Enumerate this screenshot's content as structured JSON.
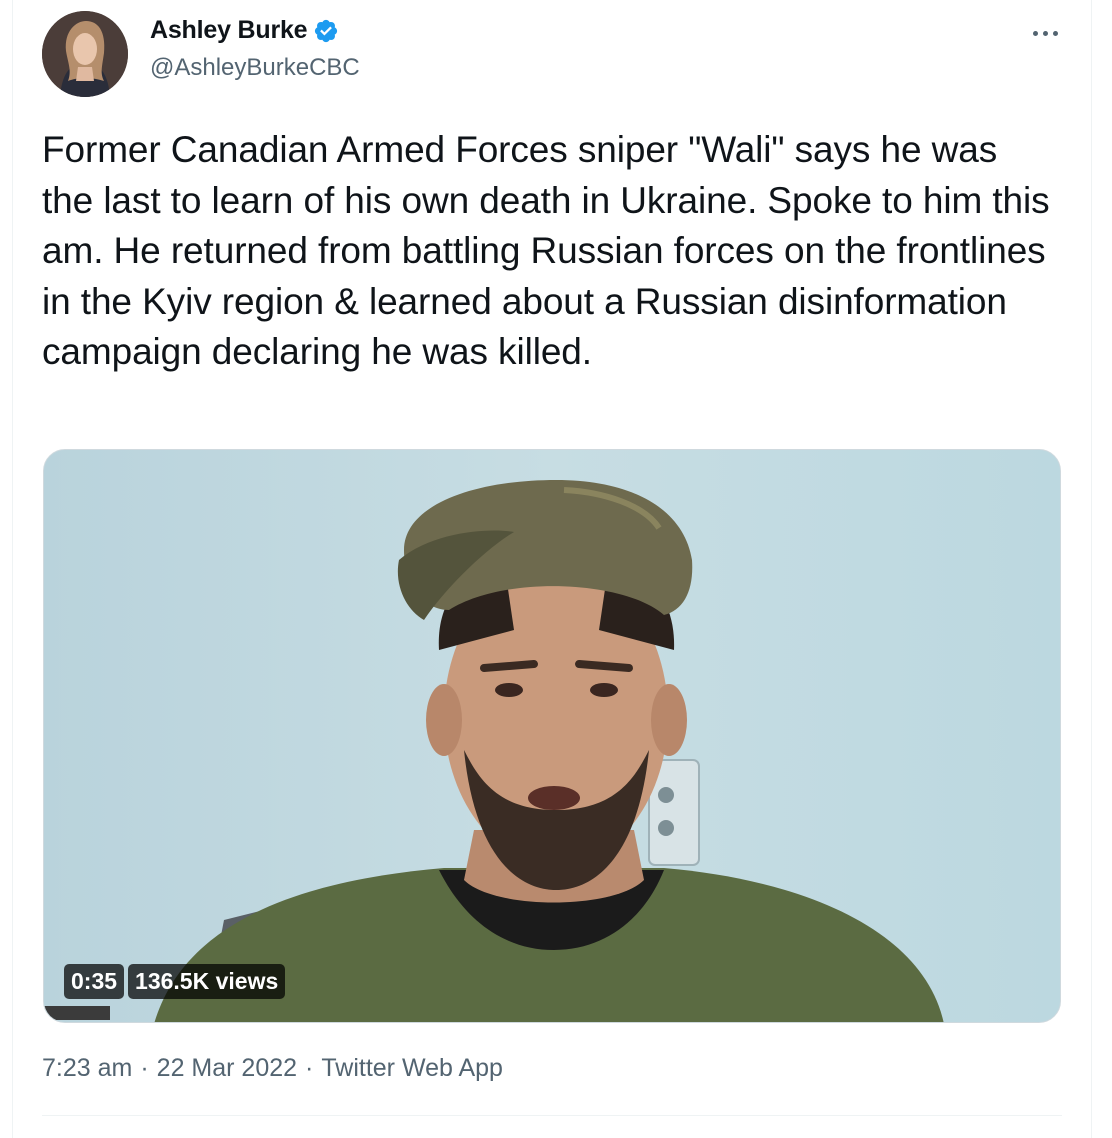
{
  "tweet": {
    "author": {
      "display_name": "Ashley Burke",
      "handle": "@AshleyBurkeCBC",
      "verified": true,
      "avatar_icon": "avatar"
    },
    "text": "Former Canadian Armed Forces sniper \"Wali\" says he was the last to learn of his own death in Ukraine. Spoke to him this am. He returned from battling Russian forces on the frontlines in the Kyiv region & learned about a Russian disinformation campaign declaring he was killed.",
    "media": {
      "type": "video",
      "duration": "0:35",
      "views": "136.5K views"
    },
    "timestamp": {
      "time": "7:23 am",
      "separator1": "·",
      "date": "22 Mar 2022",
      "separator2": "·",
      "source": "Twitter Web App"
    }
  },
  "colors": {
    "verified_badge": "#1d9bf0",
    "secondary_text": "#536471",
    "primary_text": "#0f1419"
  },
  "icons": {
    "more": "more-icon",
    "verified": "verified-icon"
  }
}
